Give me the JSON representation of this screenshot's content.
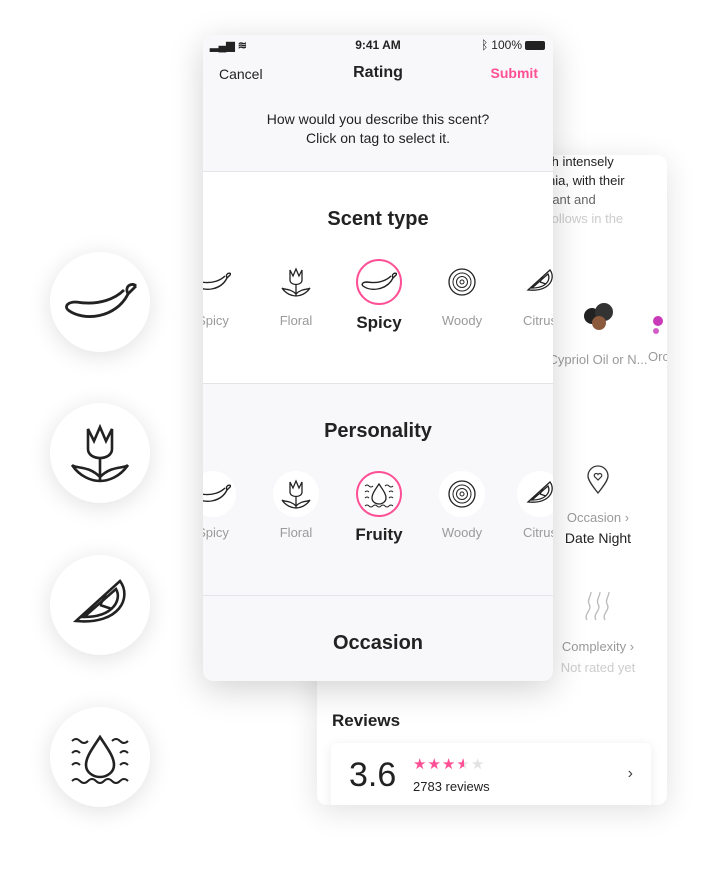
{
  "side_icons": [
    "chili-icon",
    "tulip-icon",
    "citrus-icon",
    "water-drop-icon"
  ],
  "back": {
    "desc_lines": [
      "th intensely",
      "nia, with their",
      "rant and",
      "follows in the"
    ],
    "notes": [
      {
        "label": "Cypriol Oil or N..."
      },
      {
        "label": "Orc"
      }
    ],
    "occasion": {
      "label": "Occasion ›",
      "value": "Date Night"
    },
    "complexity": {
      "label": "Complexity ›",
      "value": "Not rated yet"
    },
    "reviews": {
      "title": "Reviews",
      "score": "3.6",
      "rating": 3.6,
      "max": 5,
      "count": "2783 reviews",
      "chevron": "›"
    }
  },
  "front": {
    "status": {
      "time": "9:41 AM",
      "battery": "100%"
    },
    "nav": {
      "cancel": "Cancel",
      "title": "Rating",
      "submit": "Submit"
    },
    "prompt": [
      "How would you describe this scent?",
      "Click on tag to select it."
    ],
    "sections": [
      {
        "title": "Scent type",
        "tags": [
          "Spicy",
          "Floral",
          "Spicy",
          "Woody",
          "Citrus"
        ],
        "selected": 2
      },
      {
        "title": "Personality",
        "tags": [
          "Spicy",
          "Floral",
          "Fruity",
          "Woody",
          "Citrus"
        ],
        "selected": 2
      },
      {
        "title": "Occasion"
      }
    ]
  },
  "colors": {
    "accent": "#ff4f95",
    "star_off": "#e2e2e2"
  }
}
